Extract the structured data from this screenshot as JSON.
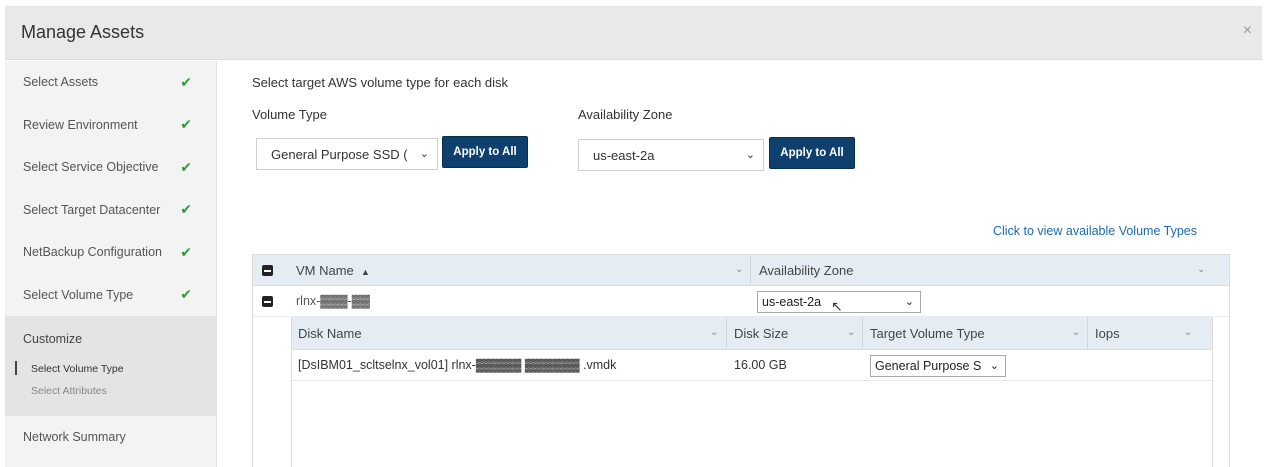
{
  "dialog": {
    "title": "Manage Assets",
    "close_label": "×"
  },
  "sidebar": {
    "steps": [
      {
        "label": "Select Assets",
        "done": true
      },
      {
        "label": "Review Environment",
        "done": true
      },
      {
        "label": "Select Service Objective",
        "done": true
      },
      {
        "label": "Select Target Datacenter",
        "done": true
      },
      {
        "label": "NetBackup Configuration",
        "done": true
      },
      {
        "label": "Select Volume Type",
        "done": true
      }
    ],
    "group": {
      "title": "Customize",
      "subitems": [
        {
          "label": "Select Volume Type",
          "active": true
        },
        {
          "label": "Select Attributes",
          "active": false
        }
      ]
    },
    "last_item": "Network Summary",
    "check_glyph": "✔"
  },
  "main": {
    "instruction": "Select target AWS volume type for each disk",
    "volume_type": {
      "label": "Volume Type",
      "value": "General Purpose SSD (",
      "apply_label": "Apply to All"
    },
    "availability_zone": {
      "label": "Availability Zone",
      "value": "us-east-2a",
      "apply_label": "Apply to All"
    },
    "view_link": "Click to view available Volume Types",
    "grid": {
      "columns": [
        "VM Name",
        "Availability Zone"
      ],
      "sort_indicator": "▲",
      "rows": [
        {
          "vm_name": "rlnx-▓▓▓-▓▓",
          "availability_zone": "us-east-2a"
        }
      ],
      "disk_grid": {
        "columns": [
          "Disk Name",
          "Disk Size",
          "Target Volume Type",
          "Iops"
        ],
        "rows": [
          {
            "disk_name": "[DsIBM01_scltselnx_vol01] rlnx-▓▓▓▓▓ ▓▓▓▓▓▓ .vmdk",
            "disk_size": "16.00 GB",
            "target_volume_type": "General Purpose S"
          }
        ]
      }
    }
  },
  "colors": {
    "primary_button": "#0f3f6c",
    "link": "#1a6bb5",
    "check": "#2e9c3a"
  }
}
